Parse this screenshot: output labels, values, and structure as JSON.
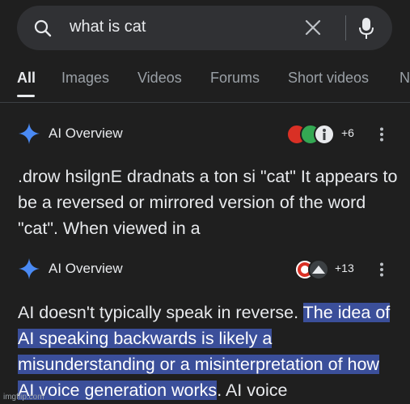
{
  "search": {
    "query": "what is cat"
  },
  "tabs": [
    {
      "label": "All",
      "active": true
    },
    {
      "label": "Images"
    },
    {
      "label": "Videos"
    },
    {
      "label": "Forums"
    },
    {
      "label": "Short videos"
    },
    {
      "label": "N"
    }
  ],
  "overviews": [
    {
      "label": "AI Overview",
      "more_sources": "+6",
      "text": ".drow hsilgnE dradnats a ton si \"cat\" It appears to be a reversed or mirrored version of the word \"cat\". When viewed in a"
    },
    {
      "label": "AI Overview",
      "more_sources": "+13",
      "text_plain": "AI doesn't typically speak in reverse. ",
      "text_highlighted": "The idea of AI speaking backwards is likely a misunderstanding or a misinterpretation of how AI voice generation works",
      "text_tail": ". AI voice"
    }
  ],
  "watermark": "imgflip.com",
  "colors": {
    "background": "#1f1f1f",
    "searchbar": "#303134",
    "highlight": "#3b4f9a",
    "sparkle": "#4a8af4"
  },
  "icons": {
    "search": "search-icon",
    "clear": "close-icon",
    "mic": "mic-icon",
    "sparkle": "sparkle-icon",
    "kebab": "more-vert-icon"
  }
}
